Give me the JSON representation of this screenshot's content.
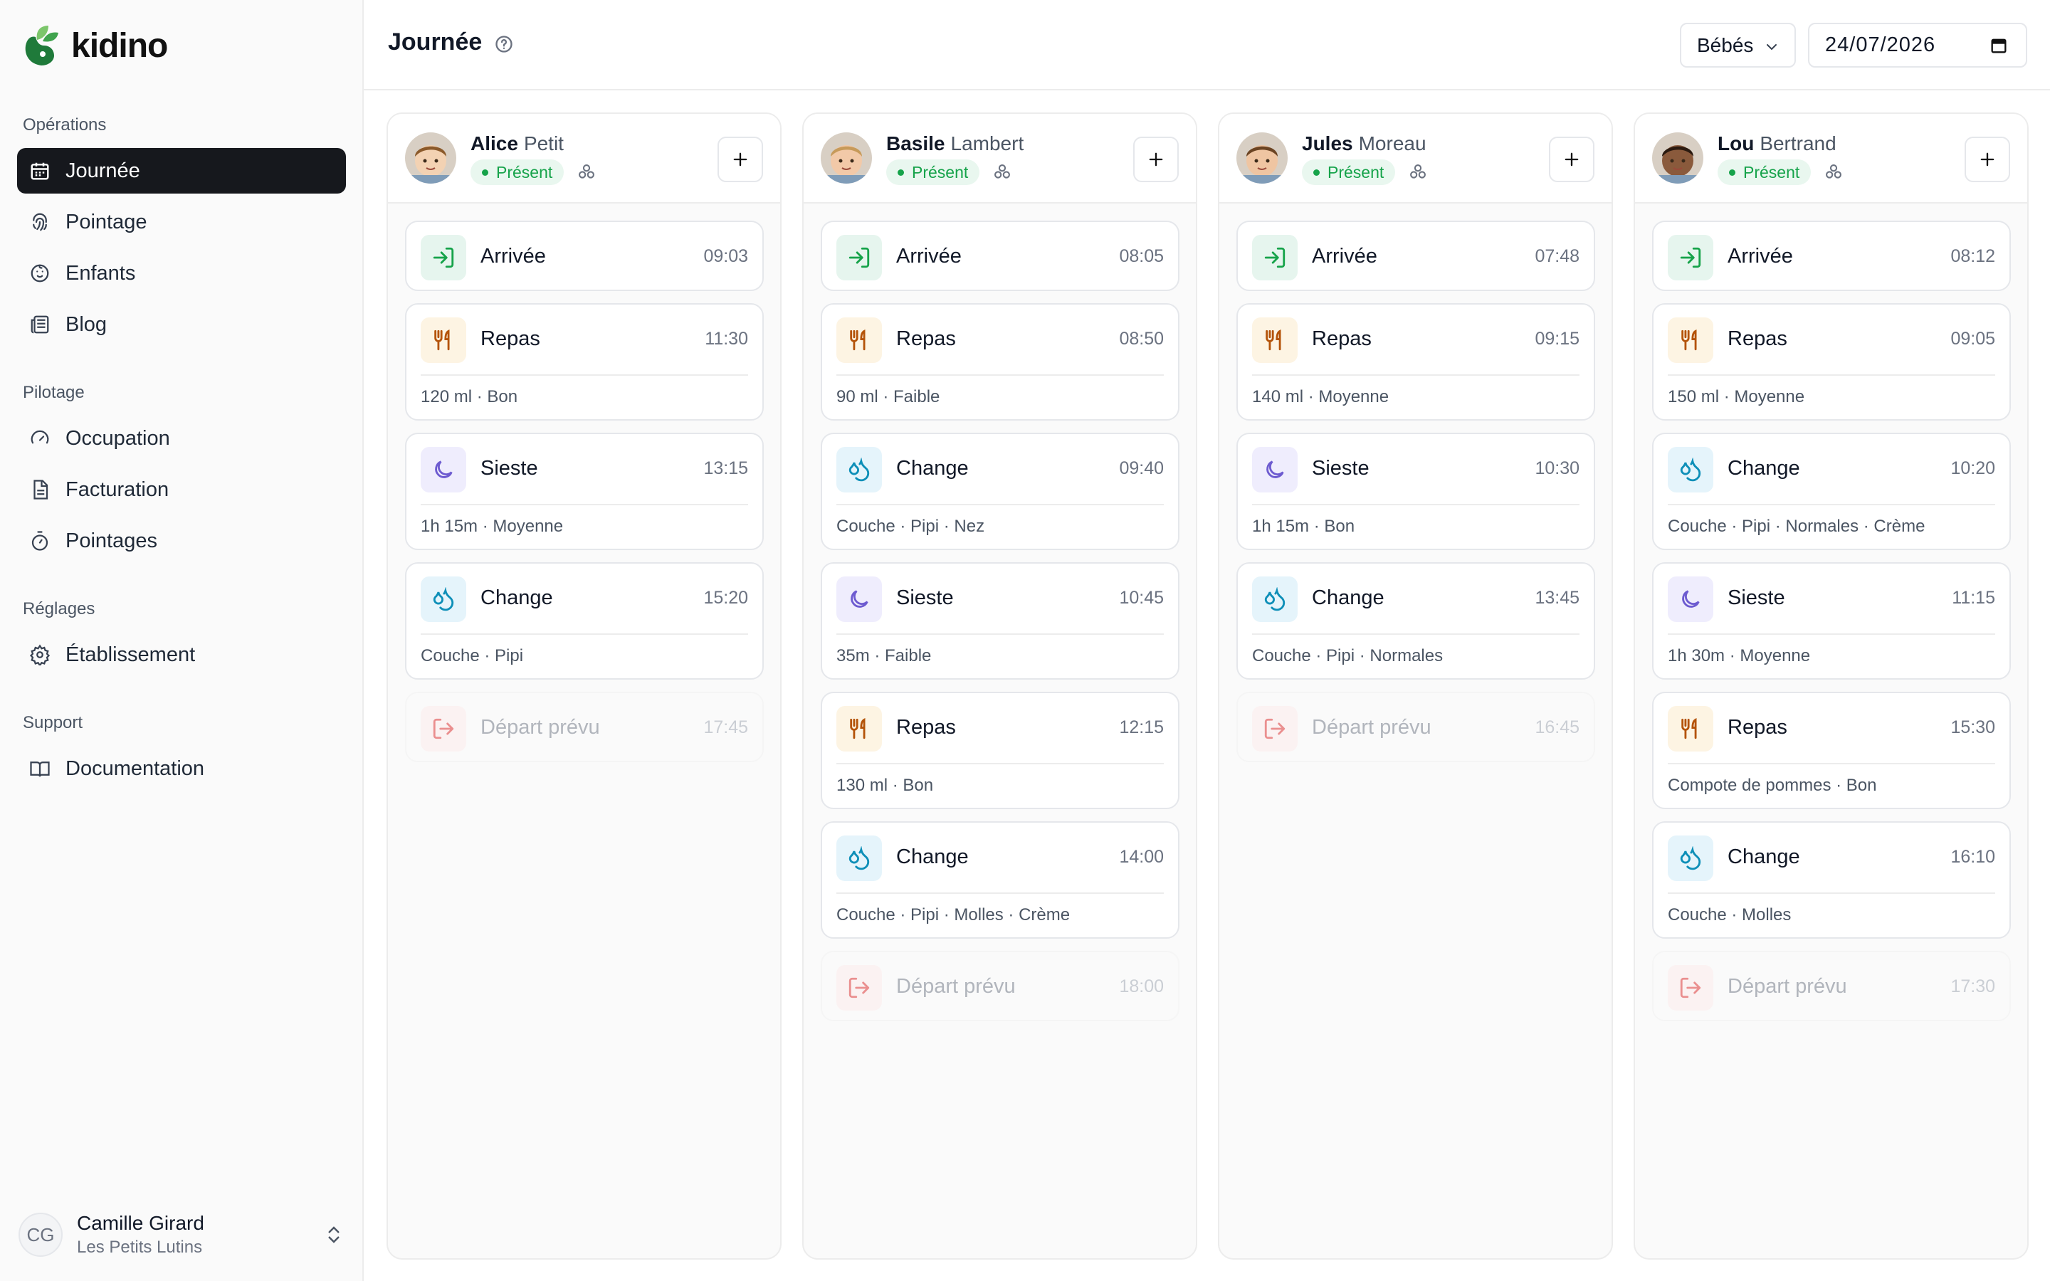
{
  "app": {
    "name": "kidino",
    "brand_color": "#2e7d32"
  },
  "sidebar": {
    "sections": [
      {
        "title": "Opérations",
        "items": [
          {
            "label": "Journée",
            "icon": "calendar-icon",
            "active": true
          },
          {
            "label": "Pointage",
            "icon": "fingerprint-icon"
          },
          {
            "label": "Enfants",
            "icon": "baby-icon"
          },
          {
            "label": "Blog",
            "icon": "newspaper-icon"
          }
        ]
      },
      {
        "title": "Pilotage",
        "items": [
          {
            "label": "Occupation",
            "icon": "gauge-icon"
          },
          {
            "label": "Facturation",
            "icon": "file-text-icon"
          },
          {
            "label": "Pointages",
            "icon": "timer-icon"
          }
        ]
      },
      {
        "title": "Réglages",
        "items": [
          {
            "label": "Établissement",
            "icon": "gear-icon"
          }
        ]
      },
      {
        "title": "Support",
        "items": [
          {
            "label": "Documentation",
            "icon": "book-icon"
          }
        ]
      }
    ],
    "user": {
      "initials": "CG",
      "name": "Camille Girard",
      "org": "Les Petits Lutins"
    }
  },
  "header": {
    "title": "Journée",
    "group_select": "Bébés",
    "date": "24/07/2026"
  },
  "columns": [
    {
      "first": "Alice",
      "last": "Petit",
      "status": "Présent",
      "events": [
        {
          "type": "Arrivée",
          "time": "09:03"
        },
        {
          "type": "Repas",
          "time": "11:30",
          "detail": "120 ml · Bon"
        },
        {
          "type": "Sieste",
          "time": "13:15",
          "detail": "1h 15m · Moyenne"
        },
        {
          "type": "Change",
          "time": "15:20",
          "detail": "Couche · Pipi"
        },
        {
          "type": "Départ prévu",
          "time": "17:45"
        }
      ]
    },
    {
      "first": "Basile",
      "last": "Lambert",
      "status": "Présent",
      "events": [
        {
          "type": "Arrivée",
          "time": "08:05"
        },
        {
          "type": "Repas",
          "time": "08:50",
          "detail": "90 ml · Faible"
        },
        {
          "type": "Change",
          "time": "09:40",
          "detail": "Couche · Pipi · Nez"
        },
        {
          "type": "Sieste",
          "time": "10:45",
          "detail": "35m · Faible"
        },
        {
          "type": "Repas",
          "time": "12:15",
          "detail": "130 ml · Bon"
        },
        {
          "type": "Change",
          "time": "14:00",
          "detail": "Couche · Pipi · Molles · Crème"
        },
        {
          "type": "Départ prévu",
          "time": "18:00"
        }
      ]
    },
    {
      "first": "Jules",
      "last": "Moreau",
      "status": "Présent",
      "events": [
        {
          "type": "Arrivée",
          "time": "07:48"
        },
        {
          "type": "Repas",
          "time": "09:15",
          "detail": "140 ml · Moyenne"
        },
        {
          "type": "Sieste",
          "time": "10:30",
          "detail": "1h 15m · Bon"
        },
        {
          "type": "Change",
          "time": "13:45",
          "detail": "Couche · Pipi · Normales"
        },
        {
          "type": "Départ prévu",
          "time": "16:45"
        }
      ]
    },
    {
      "first": "Lou",
      "last": "Bertrand",
      "status": "Présent",
      "events": [
        {
          "type": "Arrivée",
          "time": "08:12"
        },
        {
          "type": "Repas",
          "time": "09:05",
          "detail": "150 ml · Moyenne"
        },
        {
          "type": "Change",
          "time": "10:20",
          "detail": "Couche · Pipi · Normales · Crème"
        },
        {
          "type": "Sieste",
          "time": "11:15",
          "detail": "1h 30m · Moyenne"
        },
        {
          "type": "Repas",
          "time": "15:30",
          "detail": "Compote de pommes · Bon"
        },
        {
          "type": "Change",
          "time": "16:10",
          "detail": "Couche · Molles"
        },
        {
          "type": "Départ prévu",
          "time": "17:30"
        }
      ]
    }
  ],
  "colors": {
    "present": "#16a34a",
    "arrival": "#16a34a",
    "meal": "#b45309",
    "nap": "#6d5bd0",
    "change": "#0e8fb8",
    "departure": "#dc2626"
  }
}
